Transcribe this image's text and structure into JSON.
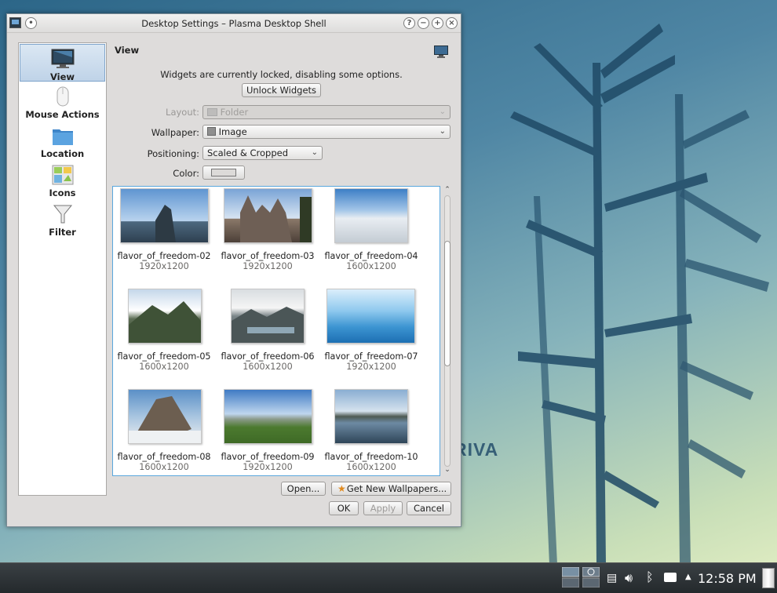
{
  "window": {
    "title": "Desktop Settings – Plasma Desktop Shell"
  },
  "brand_text": "RIVA",
  "sidebar": {
    "items": [
      {
        "label": "View",
        "icon": "monitor-icon",
        "selected": true
      },
      {
        "label": "Mouse Actions",
        "icon": "mouse-icon",
        "selected": false
      },
      {
        "label": "Location",
        "icon": "folder-icon",
        "selected": false
      },
      {
        "label": "Icons",
        "icon": "icons-icon",
        "selected": false
      },
      {
        "label": "Filter",
        "icon": "funnel-icon",
        "selected": false
      }
    ]
  },
  "panel": {
    "title": "View",
    "locked_notice": "Widgets are currently locked, disabling some options.",
    "unlock_button": "Unlock Widgets",
    "layout": {
      "label": "Layout:",
      "value": "Folder",
      "disabled": true
    },
    "wallpaper": {
      "label": "Wallpaper:",
      "value": "Image"
    },
    "positioning": {
      "label": "Positioning:",
      "value": "Scaled & Cropped"
    },
    "color": {
      "label": "Color:",
      "value": "#dcdad8"
    }
  },
  "wallpapers": [
    {
      "name": "flavor_of_freedom-02",
      "size": "1920x1200"
    },
    {
      "name": "flavor_of_freedom-03",
      "size": "1920x1200"
    },
    {
      "name": "flavor_of_freedom-04",
      "size": "1600x1200"
    },
    {
      "name": "flavor_of_freedom-05",
      "size": "1600x1200"
    },
    {
      "name": "flavor_of_freedom-06",
      "size": "1600x1200"
    },
    {
      "name": "flavor_of_freedom-07",
      "size": "1920x1200"
    },
    {
      "name": "flavor_of_freedom-08",
      "size": "1600x1200"
    },
    {
      "name": "flavor_of_freedom-09",
      "size": "1920x1200"
    },
    {
      "name": "flavor_of_freedom-10",
      "size": "1600x1200"
    }
  ],
  "buttons": {
    "open": "Open...",
    "get_new": "Get New Wallpapers...",
    "ok": "OK",
    "apply": "Apply",
    "cancel": "Cancel"
  },
  "taskbar": {
    "clock": "12:58 PM"
  },
  "colors": {
    "accent": "#5aa7dd",
    "selection": "#bfd3e8",
    "bamboo": "#1f4a66"
  }
}
